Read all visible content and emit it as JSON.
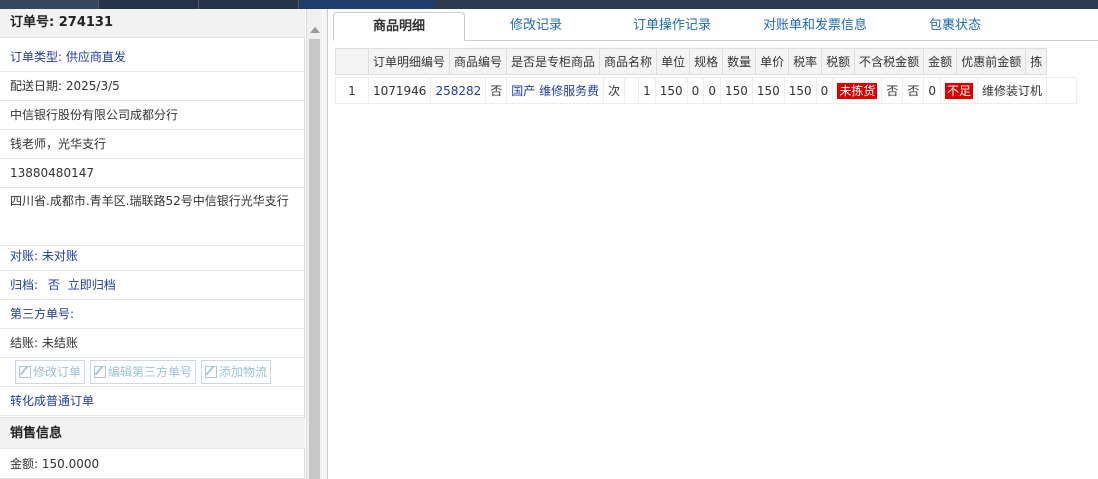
{
  "order": {
    "title": "订单号: 274131",
    "type": "订单类型: 供应商直发",
    "delivery_date": "配送日期: 2025/3/5",
    "company": "中信银行股份有限公司成都分行",
    "contact": "钱老师，光华支行",
    "phone": "13880480147",
    "address": "四川省.成都市.青羊区.瑞联路52号中信银行光华支行",
    "reconcile": "对账: 未对账",
    "archive_label": "归档:",
    "archive_value": "否",
    "archive_link": "立即归档",
    "third_party": "第三方单号:",
    "settlement": "结账: 未结账",
    "buttons": {
      "edit_order": "修改订单",
      "edit_third_party": "编辑第三方单号",
      "add_logistics": "添加物流"
    },
    "convert_link": "转化成普通订单"
  },
  "sales": {
    "header": "销售信息",
    "amount": "金额: 150.0000"
  },
  "tabs": [
    "商品明细",
    "修改记录",
    "订单操作记录",
    "对账单和发票信息",
    "包裹状态"
  ],
  "table": {
    "headers": [
      "",
      "订单明细编号",
      "商品编号",
      "是否是专柜商品",
      "商品名称",
      "单位",
      "规格",
      "数量",
      "单价",
      "税率",
      "税额",
      "不含税金额",
      "金额",
      "优惠前金额",
      "拣"
    ],
    "row": {
      "index": "1",
      "detail_id": "1071946",
      "product_id": "258282",
      "counter": "否",
      "name": "国产 维修服务费",
      "unit": "次",
      "spec": "",
      "qty": "1",
      "price": "150",
      "tax_rate": "0",
      "tax": "0",
      "no_tax_amount": "150",
      "amount": "150",
      "pre_discount": "150",
      "pick": "0",
      "pick_status": "未拣货",
      "f1": "否",
      "f2": "否",
      "f3": "0",
      "stock_status": "不足",
      "note": "维修装订机"
    }
  },
  "colors": {
    "accent": "#1f3d9c",
    "alert": "#dd0000",
    "topbar": "#2b3a4f"
  }
}
